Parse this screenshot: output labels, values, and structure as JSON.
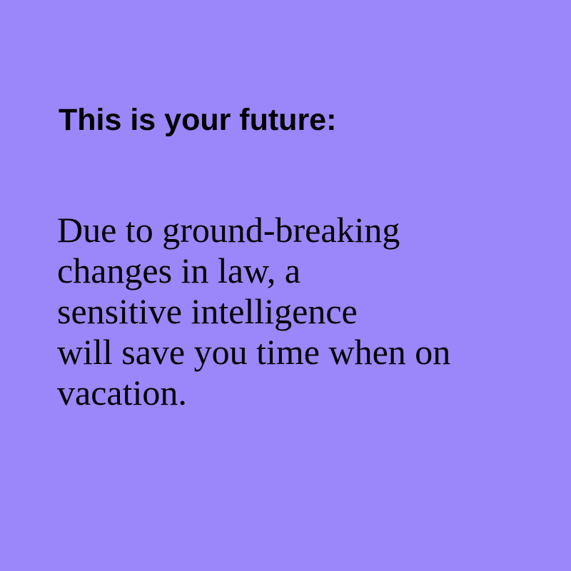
{
  "colors": {
    "background": "#9b87f9",
    "text": "#000000"
  },
  "heading": "This is your future:",
  "body": {
    "lines": [
      "Due to ground-breaking",
      "changes in law, a",
      "sensitive intelligence",
      "will save you time when on",
      "vacation."
    ]
  }
}
